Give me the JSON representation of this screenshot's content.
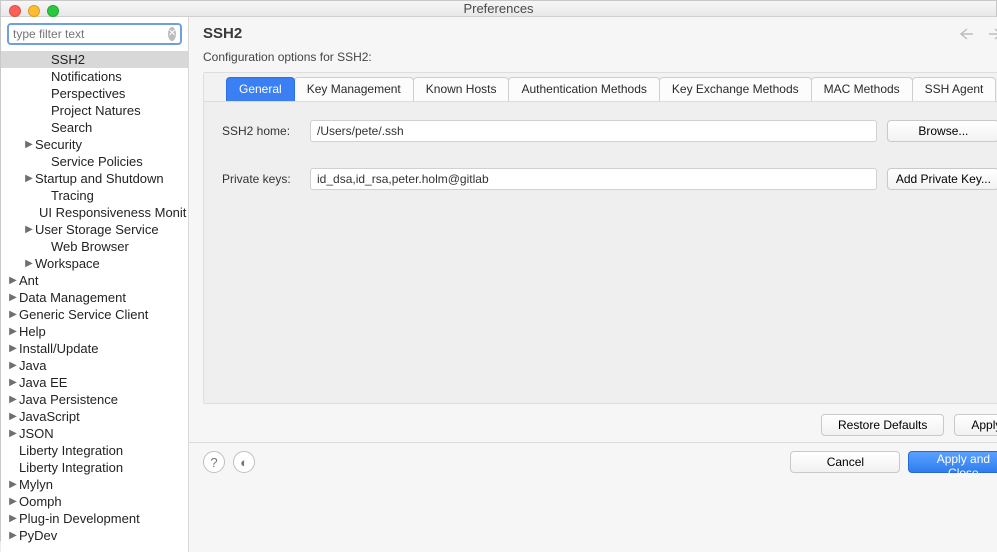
{
  "window": {
    "title": "Preferences"
  },
  "filter": {
    "placeholder": "type filter text"
  },
  "tree": [
    {
      "label": "SSH2",
      "indent": 2,
      "arrow": "none",
      "selected": true
    },
    {
      "label": "Notifications",
      "indent": 2,
      "arrow": "none"
    },
    {
      "label": "Perspectives",
      "indent": 2,
      "arrow": "none"
    },
    {
      "label": "Project Natures",
      "indent": 2,
      "arrow": "none"
    },
    {
      "label": "Search",
      "indent": 2,
      "arrow": "none"
    },
    {
      "label": "Security",
      "indent": 1,
      "arrow": "right"
    },
    {
      "label": "Service Policies",
      "indent": 2,
      "arrow": "none"
    },
    {
      "label": "Startup and Shutdown",
      "indent": 1,
      "arrow": "right"
    },
    {
      "label": "Tracing",
      "indent": 2,
      "arrow": "none"
    },
    {
      "label": "UI Responsiveness Monit",
      "indent": 2,
      "arrow": "none"
    },
    {
      "label": "User Storage Service",
      "indent": 1,
      "arrow": "right"
    },
    {
      "label": "Web Browser",
      "indent": 2,
      "arrow": "none"
    },
    {
      "label": "Workspace",
      "indent": 1,
      "arrow": "right"
    },
    {
      "label": "Ant",
      "indent": 0,
      "arrow": "right"
    },
    {
      "label": "Data Management",
      "indent": 0,
      "arrow": "right"
    },
    {
      "label": "Generic Service Client",
      "indent": 0,
      "arrow": "right"
    },
    {
      "label": "Help",
      "indent": 0,
      "arrow": "right"
    },
    {
      "label": "Install/Update",
      "indent": 0,
      "arrow": "right"
    },
    {
      "label": "Java",
      "indent": 0,
      "arrow": "right"
    },
    {
      "label": "Java EE",
      "indent": 0,
      "arrow": "right"
    },
    {
      "label": "Java Persistence",
      "indent": 0,
      "arrow": "right"
    },
    {
      "label": "JavaScript",
      "indent": 0,
      "arrow": "right"
    },
    {
      "label": "JSON",
      "indent": 0,
      "arrow": "right"
    },
    {
      "label": "Liberty Integration",
      "indent": 0,
      "arrow": "none"
    },
    {
      "label": "Liberty Integration",
      "indent": 0,
      "arrow": "none"
    },
    {
      "label": "Mylyn",
      "indent": 0,
      "arrow": "right"
    },
    {
      "label": "Oomph",
      "indent": 0,
      "arrow": "right"
    },
    {
      "label": "Plug-in Development",
      "indent": 0,
      "arrow": "right"
    },
    {
      "label": "PyDev",
      "indent": 0,
      "arrow": "right"
    }
  ],
  "main": {
    "title": "SSH2",
    "subtitle": "Configuration options for SSH2:",
    "tabs": [
      "General",
      "Key Management",
      "Known Hosts",
      "Authentication Methods",
      "Key Exchange Methods",
      "MAC Methods",
      "SSH Agent"
    ],
    "active_tab": 0,
    "fields": {
      "ssh2_home_label": "SSH2 home:",
      "ssh2_home_value": "/Users/pete/.ssh",
      "browse": "Browse...",
      "private_keys_label": "Private keys:",
      "private_keys_value": "id_dsa,id_rsa,peter.holm@gitlab",
      "add_key": "Add Private Key..."
    },
    "restore_defaults": "Restore Defaults",
    "apply": "Apply"
  },
  "footer": {
    "cancel": "Cancel",
    "apply_close": "Apply and Close"
  }
}
